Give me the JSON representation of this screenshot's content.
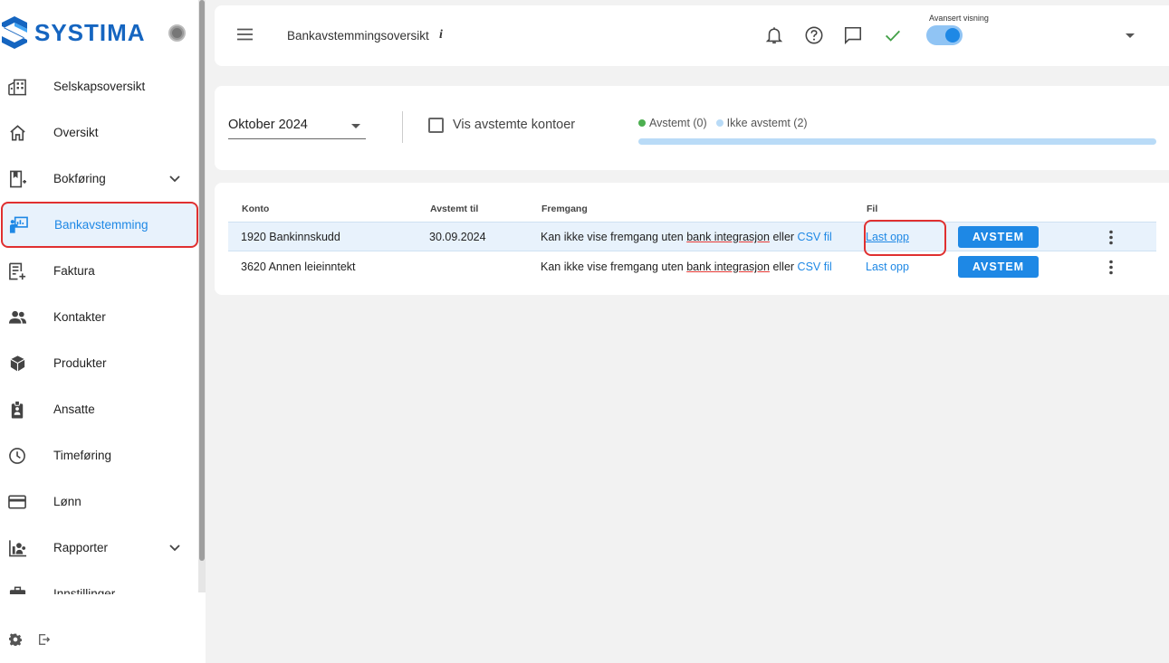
{
  "app": {
    "name": "SYSTIMA"
  },
  "sidebar": {
    "items": [
      {
        "label": "Selskapsoversikt",
        "icon": "building-icon"
      },
      {
        "label": "Oversikt",
        "icon": "home-icon"
      },
      {
        "label": "Bokføring",
        "icon": "ledger-icon",
        "expandable": true
      },
      {
        "label": "Bankavstemming",
        "icon": "bank-reconcile-icon",
        "active": true
      },
      {
        "label": "Faktura",
        "icon": "invoice-icon"
      },
      {
        "label": "Kontakter",
        "icon": "contacts-icon"
      },
      {
        "label": "Produkter",
        "icon": "product-box-icon"
      },
      {
        "label": "Ansatte",
        "icon": "employee-badge-icon"
      },
      {
        "label": "Timeføring",
        "icon": "clock-icon"
      },
      {
        "label": "Lønn",
        "icon": "card-icon"
      },
      {
        "label": "Rapporter",
        "icon": "reports-icon",
        "expandable": true
      },
      {
        "label": "Innstillinger",
        "icon": "settings-briefcase-icon"
      }
    ]
  },
  "header": {
    "title": "Bankavstemmingsoversikt",
    "info_label": "i",
    "advanced_view_label": "Avansert visning",
    "advanced_view_on": true
  },
  "filters": {
    "period_value": "Oktober 2024",
    "show_reconciled_label": "Vis avstemte kontoer",
    "show_reconciled_checked": false,
    "legend_reconciled": "Avstemt (0)",
    "legend_not_reconciled": "Ikke avstemt (2)",
    "reconciled_fraction": 0
  },
  "table": {
    "headers": {
      "account": "Konto",
      "reconciled_to": "Avstemt til",
      "progress": "Fremgang",
      "file": "Fil"
    },
    "rows": [
      {
        "account": "1920 Bankinnskudd",
        "reconciled_to": "30.09.2024",
        "progress_text": "Kan ikke vise fremgang uten",
        "progress_link": "bank integrasjon",
        "progress_or": "eller",
        "csv_link": "CSV fil",
        "file_link": "Last opp",
        "action": "AVSTEM"
      },
      {
        "account": "3620 Annen leieinntekt",
        "reconciled_to": "",
        "progress_text": "Kan ikke vise fremgang uten",
        "progress_link": "bank integrasjon",
        "progress_or": "eller",
        "csv_link": "CSV fil",
        "file_link": "Last opp",
        "action": "AVSTEM"
      }
    ]
  },
  "colors": {
    "brand": "#1565c0",
    "accent": "#1e88e5",
    "reconciled": "#4caf50",
    "not_reconciled": "#b9dbf7",
    "highlight": "#e03030"
  }
}
